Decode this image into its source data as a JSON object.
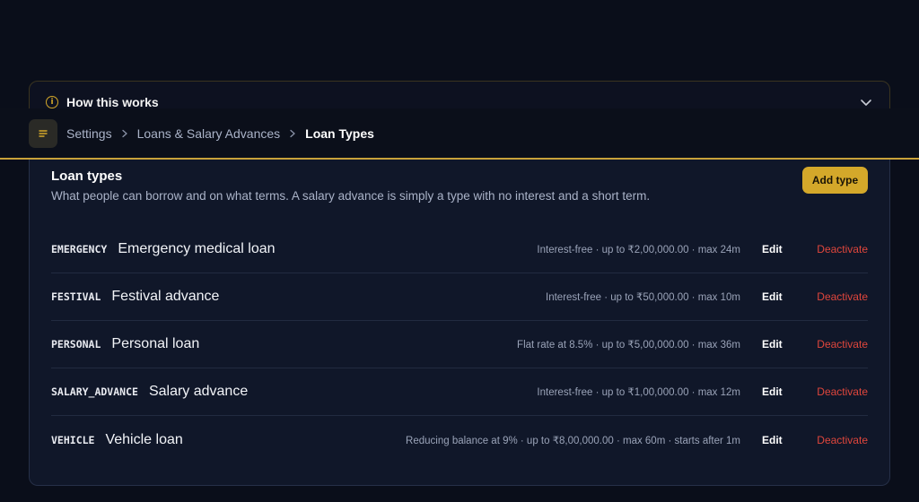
{
  "how": {
    "title": "How this works",
    "icon": "info-icon",
    "chevron": "chevron-down-icon"
  },
  "breadcrumb": {
    "menu_icon": "menu-icon",
    "items": [
      "Settings",
      "Loans & Salary Advances",
      "Loan Types"
    ]
  },
  "card": {
    "title": "Loan types",
    "subtitle": "What people can borrow and on what terms. A salary advance is simply a type with no interest and a short term.",
    "add_label": "Add type"
  },
  "loan_types": [
    {
      "code": "EMERGENCY",
      "name": "Emergency medical loan",
      "terms": "Interest-free · up to ₹2,00,000.00 · max 24m",
      "edit": "Edit",
      "deactivate": "Deactivate"
    },
    {
      "code": "FESTIVAL",
      "name": "Festival advance",
      "terms": "Interest-free · up to ₹50,000.00 · max 10m",
      "edit": "Edit",
      "deactivate": "Deactivate"
    },
    {
      "code": "PERSONAL",
      "name": "Personal loan",
      "terms": "Flat rate at 8.5% · up to ₹5,00,000.00 · max 36m",
      "edit": "Edit",
      "deactivate": "Deactivate"
    },
    {
      "code": "SALARY_ADVANCE",
      "name": "Salary advance",
      "terms": "Interest-free · up to ₹1,00,000.00 · max 12m",
      "edit": "Edit",
      "deactivate": "Deactivate"
    },
    {
      "code": "VEHICLE",
      "name": "Vehicle loan",
      "terms": "Reducing balance at 9% · up to ₹8,00,000.00 · max 60m · starts after 1m",
      "edit": "Edit",
      "deactivate": "Deactivate"
    }
  ],
  "colors": {
    "accent": "#d4a82a",
    "danger": "#e0463c",
    "background": "#0a0e1a",
    "card": "#101729"
  }
}
